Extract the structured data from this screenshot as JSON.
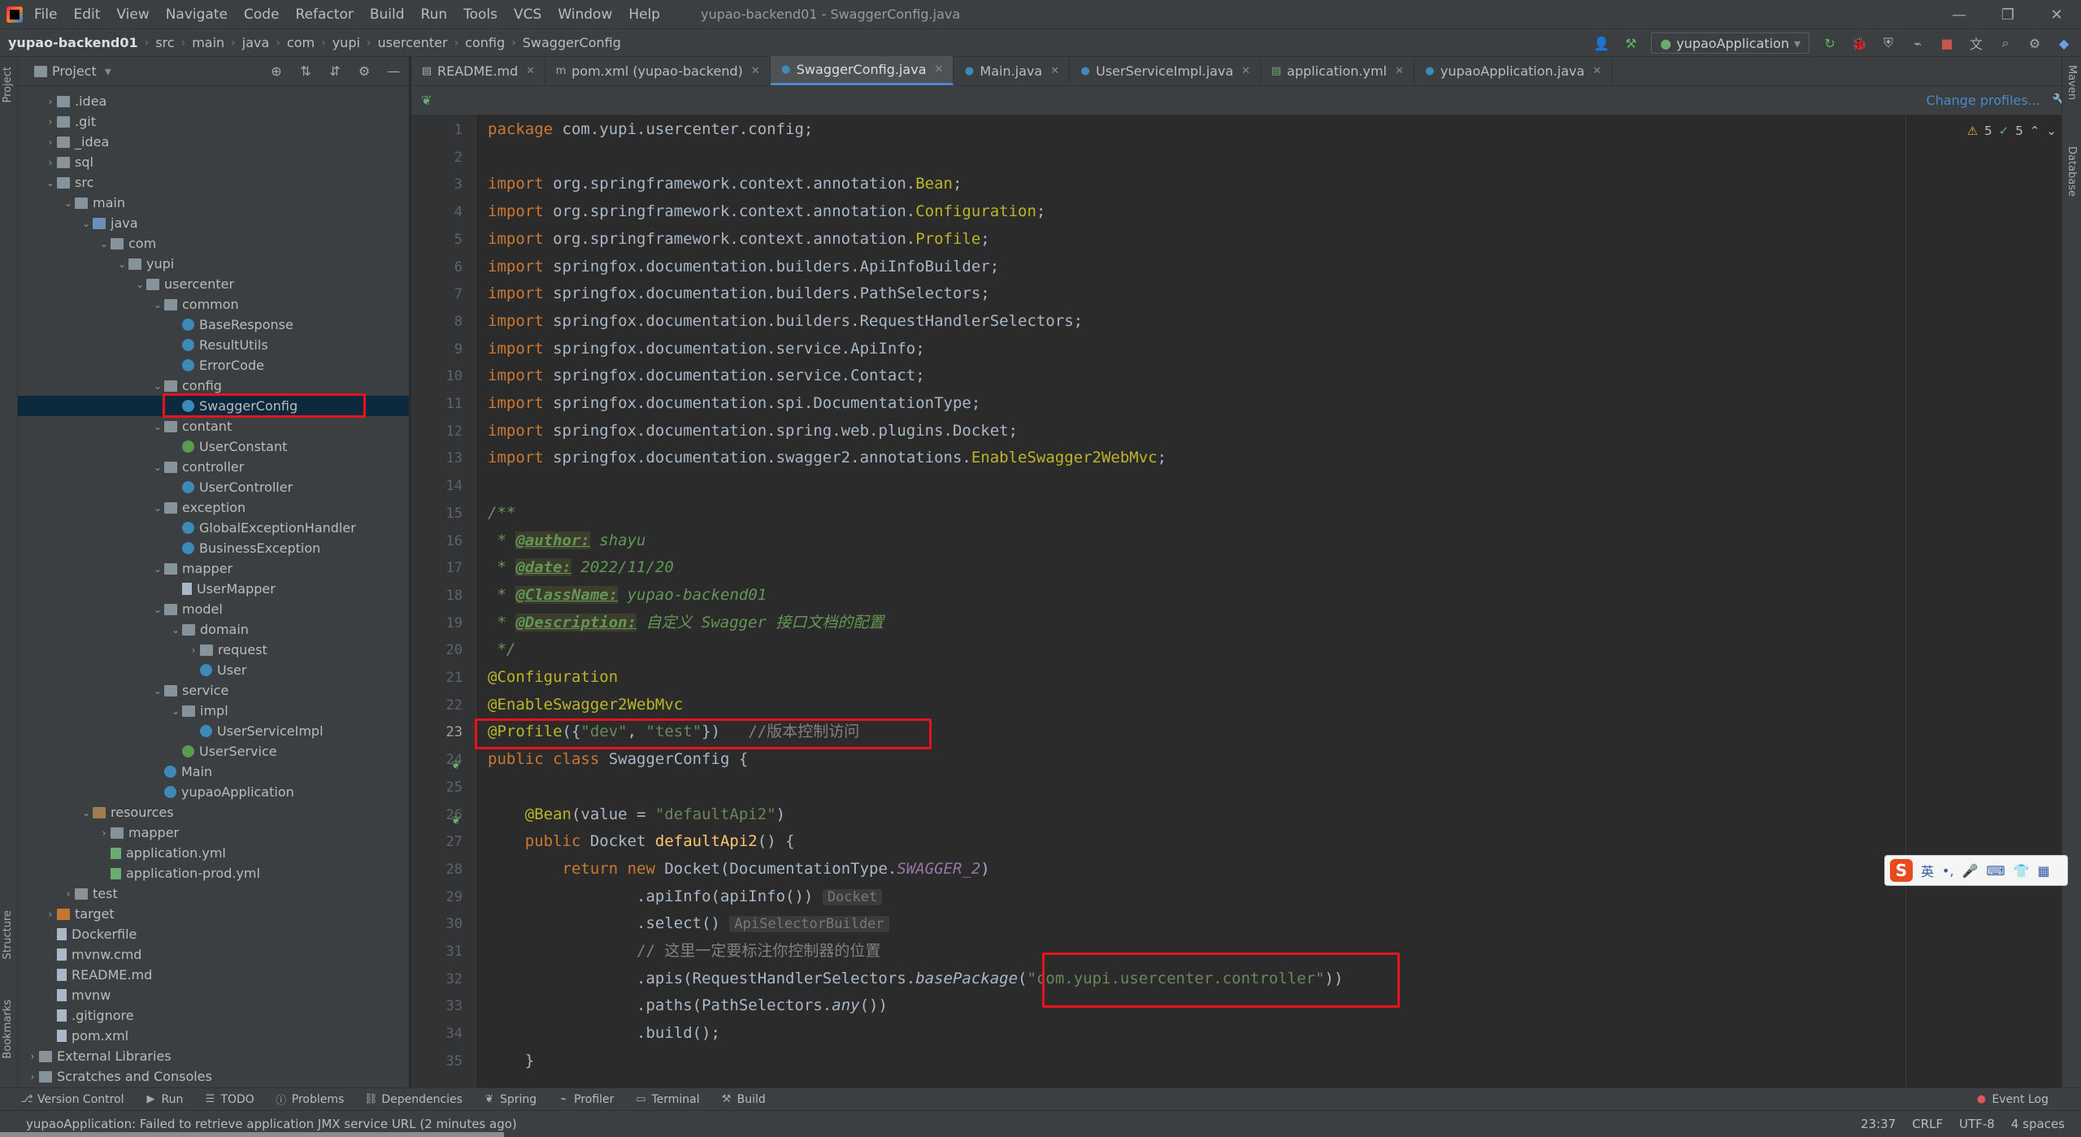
{
  "menubar": {
    "items": [
      "File",
      "Edit",
      "View",
      "Navigate",
      "Code",
      "Refactor",
      "Build",
      "Run",
      "Tools",
      "VCS",
      "Window",
      "Help"
    ],
    "window_title": "yupao-backend01 - SwaggerConfig.java"
  },
  "navbar": {
    "breadcrumbs": [
      "yupao-backend01",
      "src",
      "main",
      "java",
      "com",
      "yupi",
      "usercenter",
      "config",
      "SwaggerConfig"
    ],
    "run_config": "yupaoApplication"
  },
  "project": {
    "title": "Project",
    "tree": [
      {
        "label": ".idea",
        "depth": 1,
        "type": "folder",
        "arrow": "›"
      },
      {
        "label": ".git",
        "depth": 1,
        "type": "folder",
        "arrow": "›"
      },
      {
        "label": "_idea",
        "depth": 1,
        "type": "folder",
        "arrow": "›"
      },
      {
        "label": "sql",
        "depth": 1,
        "type": "folder",
        "arrow": "›"
      },
      {
        "label": "src",
        "depth": 1,
        "type": "folder",
        "arrow": "⌄"
      },
      {
        "label": "main",
        "depth": 2,
        "type": "folder",
        "arrow": "⌄"
      },
      {
        "label": "java",
        "depth": 3,
        "type": "src",
        "arrow": "⌄"
      },
      {
        "label": "com",
        "depth": 4,
        "type": "folder",
        "arrow": "⌄"
      },
      {
        "label": "yupi",
        "depth": 5,
        "type": "folder",
        "arrow": "⌄"
      },
      {
        "label": "usercenter",
        "depth": 6,
        "type": "folder",
        "arrow": "⌄"
      },
      {
        "label": "common",
        "depth": 7,
        "type": "folder",
        "arrow": "⌄"
      },
      {
        "label": "BaseResponse",
        "depth": 8,
        "type": "class",
        "arrow": ""
      },
      {
        "label": "ResultUtils",
        "depth": 8,
        "type": "class",
        "arrow": ""
      },
      {
        "label": "ErrorCode",
        "depth": 8,
        "type": "enum",
        "arrow": ""
      },
      {
        "label": "config",
        "depth": 7,
        "type": "folder",
        "arrow": "⌄"
      },
      {
        "label": "SwaggerConfig",
        "depth": 8,
        "type": "class",
        "arrow": "",
        "selected": true
      },
      {
        "label": "contant",
        "depth": 7,
        "type": "folder",
        "arrow": "⌄"
      },
      {
        "label": "UserConstant",
        "depth": 8,
        "type": "iface",
        "arrow": ""
      },
      {
        "label": "controller",
        "depth": 7,
        "type": "folder",
        "arrow": "⌄"
      },
      {
        "label": "UserController",
        "depth": 8,
        "type": "class",
        "arrow": ""
      },
      {
        "label": "exception",
        "depth": 7,
        "type": "folder",
        "arrow": "⌄"
      },
      {
        "label": "GlobalExceptionHandler",
        "depth": 8,
        "type": "class",
        "arrow": ""
      },
      {
        "label": "BusinessException",
        "depth": 8,
        "type": "class",
        "arrow": ""
      },
      {
        "label": "mapper",
        "depth": 7,
        "type": "folder",
        "arrow": "⌄"
      },
      {
        "label": "UserMapper",
        "depth": 8,
        "type": "mapper",
        "arrow": ""
      },
      {
        "label": "model",
        "depth": 7,
        "type": "folder",
        "arrow": "⌄"
      },
      {
        "label": "domain",
        "depth": 8,
        "type": "folder",
        "arrow": "⌄"
      },
      {
        "label": "request",
        "depth": 9,
        "type": "folder",
        "arrow": "›"
      },
      {
        "label": "User",
        "depth": 9,
        "type": "class",
        "arrow": ""
      },
      {
        "label": "service",
        "depth": 7,
        "type": "folder",
        "arrow": "⌄"
      },
      {
        "label": "impl",
        "depth": 8,
        "type": "folder",
        "arrow": "⌄"
      },
      {
        "label": "UserServiceImpl",
        "depth": 9,
        "type": "class",
        "arrow": ""
      },
      {
        "label": "UserService",
        "depth": 8,
        "type": "iface",
        "arrow": ""
      },
      {
        "label": "Main",
        "depth": 7,
        "type": "class",
        "arrow": ""
      },
      {
        "label": "yupaoApplication",
        "depth": 7,
        "type": "class",
        "arrow": ""
      },
      {
        "label": "resources",
        "depth": 3,
        "type": "res",
        "arrow": "⌄"
      },
      {
        "label": "mapper",
        "depth": 4,
        "type": "folder",
        "arrow": "›"
      },
      {
        "label": "application.yml",
        "depth": 4,
        "type": "yml",
        "arrow": ""
      },
      {
        "label": "application-prod.yml",
        "depth": 4,
        "type": "yml",
        "arrow": ""
      },
      {
        "label": "test",
        "depth": 2,
        "type": "folder",
        "arrow": "›"
      },
      {
        "label": "target",
        "depth": 1,
        "type": "ex",
        "arrow": "›"
      },
      {
        "label": "Dockerfile",
        "depth": 1,
        "type": "file",
        "arrow": ""
      },
      {
        "label": "mvnw.cmd",
        "depth": 1,
        "type": "file",
        "arrow": ""
      },
      {
        "label": "README.md",
        "depth": 1,
        "type": "file",
        "arrow": ""
      },
      {
        "label": "mvnw",
        "depth": 1,
        "type": "file",
        "arrow": ""
      },
      {
        "label": ".gitignore",
        "depth": 1,
        "type": "file",
        "arrow": ""
      },
      {
        "label": "pom.xml",
        "depth": 1,
        "type": "file",
        "arrow": ""
      },
      {
        "label": "External Libraries",
        "depth": 0,
        "type": "lib",
        "arrow": "›"
      },
      {
        "label": "Scratches and Consoles",
        "depth": 0,
        "type": "lib",
        "arrow": "›"
      }
    ]
  },
  "tabs": [
    {
      "label": "README.md",
      "active": false
    },
    {
      "label": "pom.xml (yupao-backend)",
      "active": false
    },
    {
      "label": "SwaggerConfig.java",
      "active": true
    },
    {
      "label": "Main.java",
      "active": false
    },
    {
      "label": "UserServiceImpl.java",
      "active": false
    },
    {
      "label": "application.yml",
      "active": false
    },
    {
      "label": "yupaoApplication.java",
      "active": false
    }
  ],
  "editor": {
    "change_profiles": "Change profiles...",
    "warnings": "5",
    "checks": "5",
    "lines": [
      [
        [
          "kw",
          "package "
        ],
        [
          "",
          "com.yupi.usercenter.config;"
        ]
      ],
      [],
      [
        [
          "kw",
          "import "
        ],
        [
          "",
          "org.springframework.context.annotation."
        ],
        [
          "ann",
          "Bean"
        ],
        [
          "",
          ";"
        ]
      ],
      [
        [
          "kw",
          "import "
        ],
        [
          "",
          "org.springframework.context.annotation."
        ],
        [
          "ann",
          "Configuration"
        ],
        [
          "",
          ";"
        ]
      ],
      [
        [
          "kw",
          "import "
        ],
        [
          "",
          "org.springframework.context.annotation."
        ],
        [
          "ann",
          "Profile"
        ],
        [
          "",
          ";"
        ]
      ],
      [
        [
          "kw",
          "import "
        ],
        [
          "",
          "springfox.documentation.builders.ApiInfoBuilder;"
        ]
      ],
      [
        [
          "kw",
          "import "
        ],
        [
          "",
          "springfox.documentation.builders.PathSelectors;"
        ]
      ],
      [
        [
          "kw",
          "import "
        ],
        [
          "",
          "springfox.documentation.builders.RequestHandlerSelectors;"
        ]
      ],
      [
        [
          "kw",
          "import "
        ],
        [
          "",
          "springfox.documentation.service.ApiInfo;"
        ]
      ],
      [
        [
          "kw",
          "import "
        ],
        [
          "",
          "springfox.documentation.service.Contact;"
        ]
      ],
      [
        [
          "kw",
          "import "
        ],
        [
          "",
          "springfox.documentation.spi.DocumentationType;"
        ]
      ],
      [
        [
          "kw",
          "import "
        ],
        [
          "",
          "springfox.documentation.spring.web.plugins.Docket;"
        ]
      ],
      [
        [
          "kw",
          "import "
        ],
        [
          "",
          "springfox.documentation.swagger2.annotations."
        ],
        [
          "ann",
          "EnableSwagger2WebMvc"
        ],
        [
          "",
          ";"
        ]
      ],
      [],
      [
        [
          "doc",
          "/**"
        ]
      ],
      [
        [
          "doc",
          " * "
        ],
        [
          "doctag",
          "@author:"
        ],
        [
          "doc",
          " shayu"
        ]
      ],
      [
        [
          "doc",
          " * "
        ],
        [
          "doctag",
          "@date:"
        ],
        [
          "doc",
          " 2022/11/20"
        ]
      ],
      [
        [
          "doc",
          " * "
        ],
        [
          "doctag",
          "@ClassName:"
        ],
        [
          "doc",
          " yupao-backend01"
        ]
      ],
      [
        [
          "doc",
          " * "
        ],
        [
          "doctag",
          "@Description:"
        ],
        [
          "doc",
          " 自定义 Swagger 接口文档的配置"
        ]
      ],
      [
        [
          "doc",
          " */"
        ]
      ],
      [
        [
          "ann",
          "@Configuration"
        ]
      ],
      [
        [
          "ann",
          "@EnableSwagger2WebMvc"
        ]
      ],
      [
        [
          "ann",
          "@Profile"
        ],
        [
          "",
          "({"
        ],
        [
          "str",
          "\"dev\""
        ],
        [
          "",
          ", "
        ],
        [
          "str",
          "\"test\""
        ],
        [
          "",
          "})   "
        ],
        [
          "cmt",
          "//版本控制访问"
        ]
      ],
      [
        [
          "kw",
          "public class "
        ],
        [
          "",
          "SwaggerConfig {"
        ]
      ],
      [],
      [
        [
          "",
          "    "
        ],
        [
          "ann",
          "@Bean"
        ],
        [
          "",
          "(value = "
        ],
        [
          "str",
          "\"defaultApi2\""
        ],
        [
          "",
          ")"
        ]
      ],
      [
        [
          "",
          "    "
        ],
        [
          "kw",
          "public "
        ],
        [
          "",
          "Docket "
        ],
        [
          "fn",
          "defaultApi2"
        ],
        [
          "",
          "() {"
        ]
      ],
      [
        [
          "",
          "        "
        ],
        [
          "kw",
          "return new "
        ],
        [
          "",
          "Docket(DocumentationType."
        ],
        [
          "ital",
          "SWAGGER_2"
        ],
        [
          "",
          ")"
        ]
      ],
      [
        [
          "",
          "                .apiInfo(apiInfo()) "
        ],
        [
          "hint",
          "Docket"
        ]
      ],
      [
        [
          "",
          "                .select() "
        ],
        [
          "hint",
          "ApiSelectorBuilder"
        ]
      ],
      [
        [
          "",
          "                "
        ],
        [
          "cmt",
          "// 这里一定要标注你控制器的位置"
        ]
      ],
      [
        [
          "",
          "                .apis(RequestHandlerSelectors."
        ],
        [
          "static",
          "basePackage"
        ],
        [
          "",
          "("
        ],
        [
          "str",
          "\"com.yupi.usercenter.controller\""
        ],
        [
          "",
          "))"
        ]
      ],
      [
        [
          "",
          "                .paths(PathSelectors."
        ],
        [
          "static",
          "any"
        ],
        [
          "",
          "())"
        ]
      ],
      [
        [
          "",
          "                .build();"
        ]
      ],
      [
        [
          "",
          "    }"
        ]
      ]
    ]
  },
  "toolwindows": [
    "Version Control",
    "Run",
    "TODO",
    "Problems",
    "Dependencies",
    "Spring",
    "Profiler",
    "Terminal",
    "Build"
  ],
  "event_log": "Event Log",
  "left_labels": [
    "Project",
    "Structure",
    "Bookmarks"
  ],
  "right_labels": [
    "Maven",
    "Database"
  ],
  "ime": {
    "lang": "英"
  },
  "status": {
    "message": "yupaoApplication: Failed to retrieve application JMX service URL (2 minutes ago)",
    "position": "23:37",
    "line_sep": "CRLF",
    "encoding": "UTF-8",
    "indent": "4 spaces"
  }
}
